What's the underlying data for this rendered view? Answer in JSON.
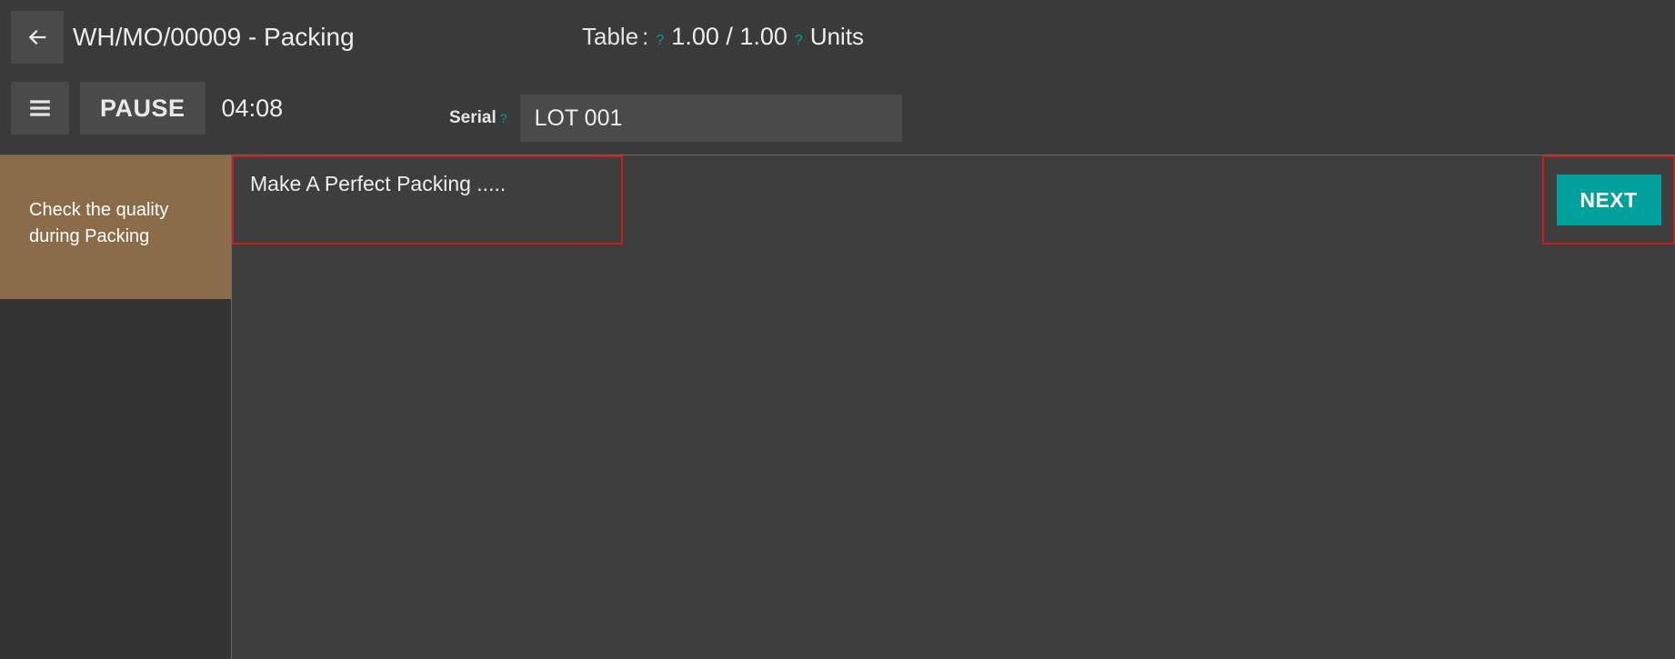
{
  "header": {
    "title": "WH/MO/00009 - Packing",
    "summary_label": "Table",
    "summary_colon": ":",
    "summary_values": "1.00 / 1.00",
    "summary_unit": "Units",
    "help_mark": "?"
  },
  "controls": {
    "pause_label": "PAUSE",
    "timer": "04:08",
    "serial_label": "Serial",
    "serial_value": "LOT 001",
    "serial_help": "?"
  },
  "step": {
    "side_text": "Check the quality during Packing",
    "instruction": "Make A Perfect Packing .....",
    "next_label": "NEXT"
  }
}
